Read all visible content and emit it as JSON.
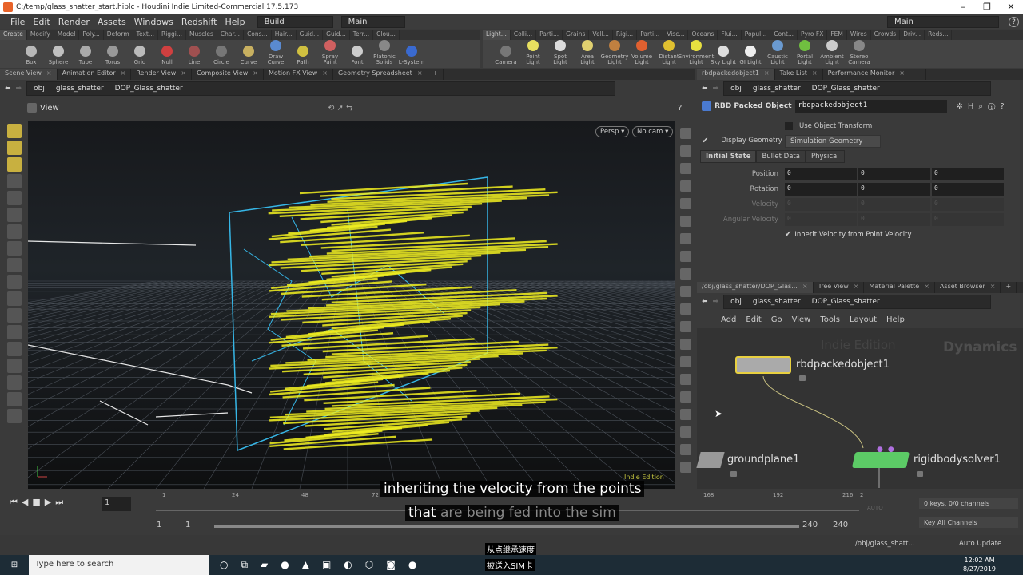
{
  "window": {
    "title": "C:/temp/glass_shatter_start.hiplc - Houdini Indie Limited-Commercial 17.5.173",
    "minimize": "–",
    "restore": "❐",
    "close": "✕"
  },
  "menu": {
    "items": [
      "File",
      "Edit",
      "Render",
      "Assets",
      "Windows",
      "Redshift",
      "Help"
    ],
    "desktop": "Build",
    "context": "Main",
    "right_desktop": "Main",
    "help": "?"
  },
  "shelf_left": {
    "tabs": [
      "Create",
      "Modify",
      "Model",
      "Poly...",
      "Deform",
      "Text...",
      "Riggi...",
      "Muscles",
      "Char...",
      "Cons...",
      "Hair...",
      "Guid...",
      "Guid...",
      "Terr...",
      "Clou..."
    ],
    "tools": [
      {
        "label": "Box",
        "color": "#b8b8b8"
      },
      {
        "label": "Sphere",
        "color": "#c0c0c0"
      },
      {
        "label": "Tube",
        "color": "#aaa"
      },
      {
        "label": "Torus",
        "color": "#999"
      },
      {
        "label": "Grid",
        "color": "#bbb"
      },
      {
        "label": "Null",
        "color": "#d04040"
      },
      {
        "label": "Line",
        "color": "#a05050"
      },
      {
        "label": "Circle",
        "color": "#777"
      },
      {
        "label": "Curve",
        "color": "#c8b060"
      },
      {
        "label": "Draw Curve",
        "color": "#5a8ad0"
      },
      {
        "label": "Path",
        "color": "#d0c040"
      },
      {
        "label": "Spray Paint",
        "color": "#d06060"
      },
      {
        "label": "Font",
        "color": "#ccc"
      },
      {
        "label": "Platonic Solids",
        "color": "#888"
      },
      {
        "label": "L-System",
        "color": "#3a6ad0"
      }
    ]
  },
  "shelf_right": {
    "tabs": [
      "Light...",
      "Colli...",
      "Parti...",
      "Grains",
      "Vell...",
      "Rigi...",
      "Parti...",
      "Visc...",
      "Oceans",
      "Flui...",
      "Popul...",
      "Cont...",
      "Pyro FX",
      "FEM",
      "Wires",
      "Crowds",
      "Driv...",
      "Reds..."
    ],
    "tools": [
      {
        "label": "Camera",
        "color": "#777"
      },
      {
        "label": "Point Light",
        "color": "#e8e060"
      },
      {
        "label": "Spot Light",
        "color": "#ddd"
      },
      {
        "label": "Area Light",
        "color": "#e0d070"
      },
      {
        "label": "Geometry Light",
        "color": "#c08040"
      },
      {
        "label": "Volume Light",
        "color": "#e06030"
      },
      {
        "label": "Distant Light",
        "color": "#e0c030"
      },
      {
        "label": "Environment Light",
        "color": "#e8e040"
      },
      {
        "label": "Sky Light",
        "color": "#ddd"
      },
      {
        "label": "GI Light",
        "color": "#eee"
      },
      {
        "label": "Caustic Light",
        "color": "#6a9ad0"
      },
      {
        "label": "Portal Light",
        "color": "#70c040"
      },
      {
        "label": "Ambient Light",
        "color": "#ccc"
      },
      {
        "label": "Stereo Camera",
        "color": "#888"
      }
    ]
  },
  "scene_pane": {
    "tabs": [
      "Scene View",
      "Animation Editor",
      "Render View",
      "Composite View",
      "Motion FX View",
      "Geometry Spreadsheet"
    ],
    "path": [
      "obj",
      "glass_shatter",
      "DOP_Glass_shatter"
    ],
    "view_label": "View",
    "persp": "Persp ▾",
    "cam": "No cam ▾",
    "watermark": "Indie Edition"
  },
  "param_pane": {
    "tabs": [
      "rbdpackedobject1",
      "Take List",
      "Performance Monitor"
    ],
    "path": [
      "obj",
      "glass_shatter",
      "DOP_Glass_shatter"
    ],
    "node_type": "RBD Packed Object",
    "node_name": "rbdpackedobject1",
    "use_object_transform": "Use Object Transform",
    "use_object_transform_checked": false,
    "display_geometry_label": "Display Geometry",
    "display_geometry_checked": true,
    "display_geometry_value": "Simulation Geometry",
    "subtabs": [
      "Initial State",
      "Bullet Data",
      "Physical"
    ],
    "rows": [
      {
        "label": "Position",
        "values": [
          "0",
          "0",
          "0"
        ],
        "enabled": true
      },
      {
        "label": "Rotation",
        "values": [
          "0",
          "0",
          "0"
        ],
        "enabled": true
      },
      {
        "label": "Velocity",
        "values": [
          "0",
          "0",
          "0"
        ],
        "enabled": false
      },
      {
        "label": "Angular Velocity",
        "values": [
          "0",
          "0",
          "0"
        ],
        "enabled": false
      }
    ],
    "inherit_velocity": "Inherit Velocity from Point Velocity",
    "inherit_velocity_checked": true
  },
  "network_pane": {
    "tabs": [
      "/obj/glass_shatter/DOP_Glas...",
      "Tree View",
      "Material Palette",
      "Asset Browser"
    ],
    "path": [
      "obj",
      "glass_shatter",
      "DOP_Glass_shatter"
    ],
    "menu": [
      "Add",
      "Edit",
      "Go",
      "View",
      "Tools",
      "Layout",
      "Help"
    ],
    "watermark": "Indie Edition",
    "context_label": "Dynamics",
    "nodes": {
      "rbd": "rbdpackedobject1",
      "ground": "groundplane1",
      "solver": "rigidbodysolver1"
    }
  },
  "timeline": {
    "current_frame": "1",
    "ticks": [
      "1",
      "24",
      "48",
      "72",
      "168",
      "192",
      "216",
      "2"
    ],
    "start": "1",
    "start2": "1",
    "end": "240",
    "end2": "240",
    "keys": "0 keys, 0/0 channels",
    "key_all": "Key All Channels",
    "auto": "AUTO"
  },
  "subtitles": {
    "line1": "inheriting the velocity from the points",
    "line2_a": "that",
    "line2_b": "are being fed into the sim",
    "cn1": "从点继承速度",
    "cn2": "被送入SIM卡"
  },
  "statusbar": {
    "path": "/obj/glass_shatt...",
    "update": "Auto Update"
  },
  "taskbar": {
    "search": "Type here to search",
    "time": "12:02 AM",
    "date": "8/27/2019"
  }
}
